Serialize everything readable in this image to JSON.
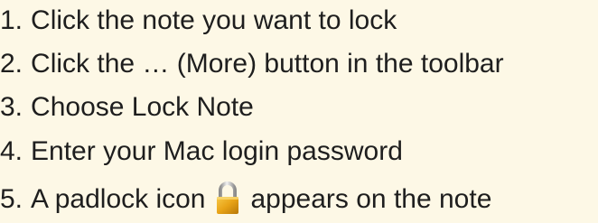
{
  "steps": [
    {
      "number": "1.",
      "text": "Click the note you want to lock"
    },
    {
      "number": "2.",
      "text": "Click the … (More) button in the toolbar"
    },
    {
      "number": "3.",
      "text": "Choose Lock Note"
    },
    {
      "number": "4.",
      "text": "Enter your Mac login password"
    },
    {
      "number": "5.",
      "text_before": "A padlock icon",
      "text_after": "appears on the note",
      "icon": "padlock-icon"
    }
  ],
  "colors": {
    "background": "#fdf8e6",
    "text": "#1e1e1e",
    "padlock_body": "#e8a317",
    "padlock_shackle": "#b8b8b8"
  }
}
